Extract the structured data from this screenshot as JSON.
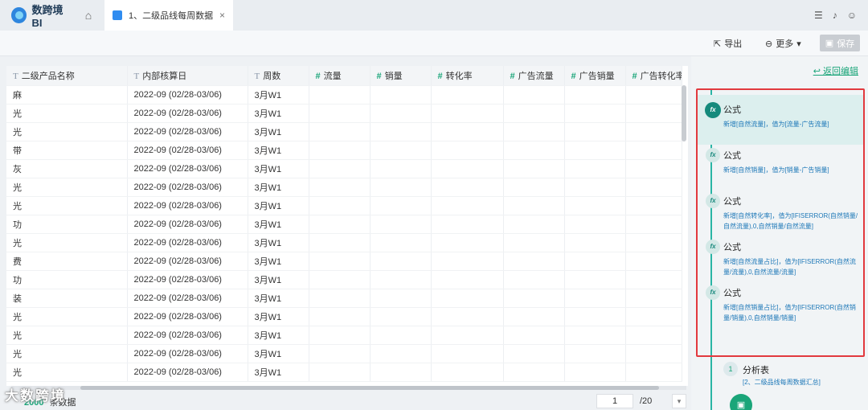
{
  "app": {
    "brand": "数跨境BI"
  },
  "tab": {
    "label": "1、二级品线每周数据",
    "close": "×"
  },
  "toolbar": {
    "export": "导出",
    "more": "更多",
    "save": "保存"
  },
  "table": {
    "columns": [
      {
        "label": "二级产品名称",
        "kind": "text"
      },
      {
        "label": "内部核算日",
        "kind": "text"
      },
      {
        "label": "周数",
        "kind": "text"
      },
      {
        "label": "流量",
        "kind": "num"
      },
      {
        "label": "销量",
        "kind": "num"
      },
      {
        "label": "转化率",
        "kind": "num"
      },
      {
        "label": "广告流量",
        "kind": "num"
      },
      {
        "label": "广告销量",
        "kind": "num"
      },
      {
        "label": "广告转化率",
        "kind": "num"
      }
    ],
    "rows": [
      {
        "name": "麻",
        "date": "2022-09 (02/28-03/06)",
        "week": "3月W1"
      },
      {
        "name": "光",
        "date": "2022-09 (02/28-03/06)",
        "week": "3月W1"
      },
      {
        "name": "光",
        "date": "2022-09 (02/28-03/06)",
        "week": "3月W1"
      },
      {
        "name": "带",
        "date": "2022-09 (02/28-03/06)",
        "week": "3月W1"
      },
      {
        "name": "灰",
        "date": "2022-09 (02/28-03/06)",
        "week": "3月W1"
      },
      {
        "name": "光",
        "date": "2022-09 (02/28-03/06)",
        "week": "3月W1"
      },
      {
        "name": "光",
        "date": "2022-09 (02/28-03/06)",
        "week": "3月W1"
      },
      {
        "name": "功",
        "date": "2022-09 (02/28-03/06)",
        "week": "3月W1"
      },
      {
        "name": "光",
        "date": "2022-09 (02/28-03/06)",
        "week": "3月W1"
      },
      {
        "name": "费",
        "date": "2022-09 (02/28-03/06)",
        "week": "3月W1"
      },
      {
        "name": "功",
        "date": "2022-09 (02/28-03/06)",
        "week": "3月W1"
      },
      {
        "name": "装",
        "date": "2022-09 (02/28-03/06)",
        "week": "3月W1"
      },
      {
        "name": "光",
        "date": "2022-09 (02/28-03/06)",
        "week": "3月W1"
      },
      {
        "name": "光",
        "date": "2022-09 (02/28-03/06)",
        "week": "3月W1"
      },
      {
        "name": "光",
        "date": "2022-09 (02/28-03/06)",
        "week": "3月W1"
      },
      {
        "name": "光",
        "date": "2022-09 (02/28-03/06)",
        "week": "3月W1"
      }
    ]
  },
  "footer": {
    "count": "2000",
    "count_suffix": "条数据",
    "page": "1",
    "total_pages": "/20",
    "watermark": "大数跨境"
  },
  "panel": {
    "back": "返回编辑",
    "steps": [
      {
        "title": "公式",
        "desc": "新增[自然流量]，值为[流量-广告流量]"
      },
      {
        "title": "公式",
        "desc": "新增[自然销量]，值为[销量-广告销量]"
      },
      {
        "title": "公式",
        "desc": "新增[自然转化率]，值为[IFISERROR(自然销量/自然流量),0,自然销量/自然流量]"
      },
      {
        "title": "公式",
        "desc": "新增[自然流量占比]，值为[IFISERROR(自然流量/流量),0,自然流量/流量]"
      },
      {
        "title": "公式",
        "desc": "新增[自然销量占比]，值为[IFISERROR(自然销量/销量),0,自然销量/销量]"
      }
    ],
    "analysis": {
      "num": "1",
      "title": "分析表",
      "sub": "[2、二级品线每周数据汇总]"
    }
  },
  "colors": {
    "accent": "#1aa579",
    "highlight": "#e2393e",
    "link": "#1e78b8"
  }
}
